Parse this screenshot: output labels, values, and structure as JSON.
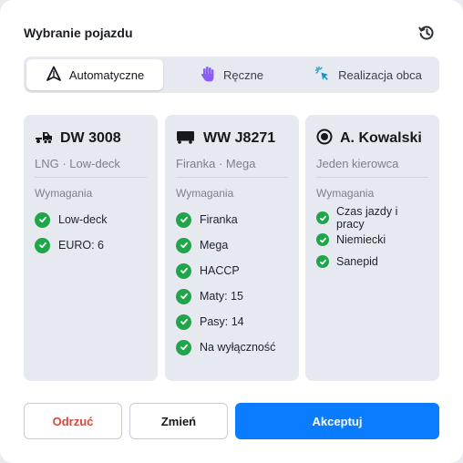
{
  "dialog": {
    "title": "Wybranie pojazdu"
  },
  "tabs": [
    {
      "label": "Automatyczne",
      "icon": "autopilot-arrow-icon",
      "active": true
    },
    {
      "label": "Ręczne",
      "icon": "hand-icon",
      "active": false
    },
    {
      "label": "Realizacja obca",
      "icon": "cursor-click-icon",
      "active": false
    }
  ],
  "cards": [
    {
      "title": "DW 3008",
      "subtitle": "LNG · Low-deck",
      "icon": "tractor-truck-icon",
      "requirements_label": "Wymagania",
      "requirements": [
        "Low-deck",
        "EURO: 6"
      ]
    },
    {
      "title": "WW J8271",
      "subtitle": "Firanka · Mega",
      "icon": "trailer-icon",
      "requirements_label": "Wymagania",
      "requirements": [
        "Firanka",
        "Mega",
        "HACCP",
        "Maty: 15",
        "Pasy: 14",
        "Na wyłączność"
      ]
    },
    {
      "title": "A. Kowalski",
      "subtitle": "Jeden kierowca",
      "icon": "driver-radio-icon",
      "requirements_label": "Wymagania",
      "requirements": [
        "Czas jazdy i pracy",
        "Niemiecki",
        "Sanepid"
      ]
    }
  ],
  "buttons": {
    "reject": "Odrzuć",
    "change": "Zmień",
    "accept": "Akceptuj"
  },
  "colors": {
    "accent": "#0a7cff",
    "check": "#1fa64a",
    "danger": "#d9443b",
    "hand": "#8b5cf6",
    "cursor": "#22a5d6"
  }
}
